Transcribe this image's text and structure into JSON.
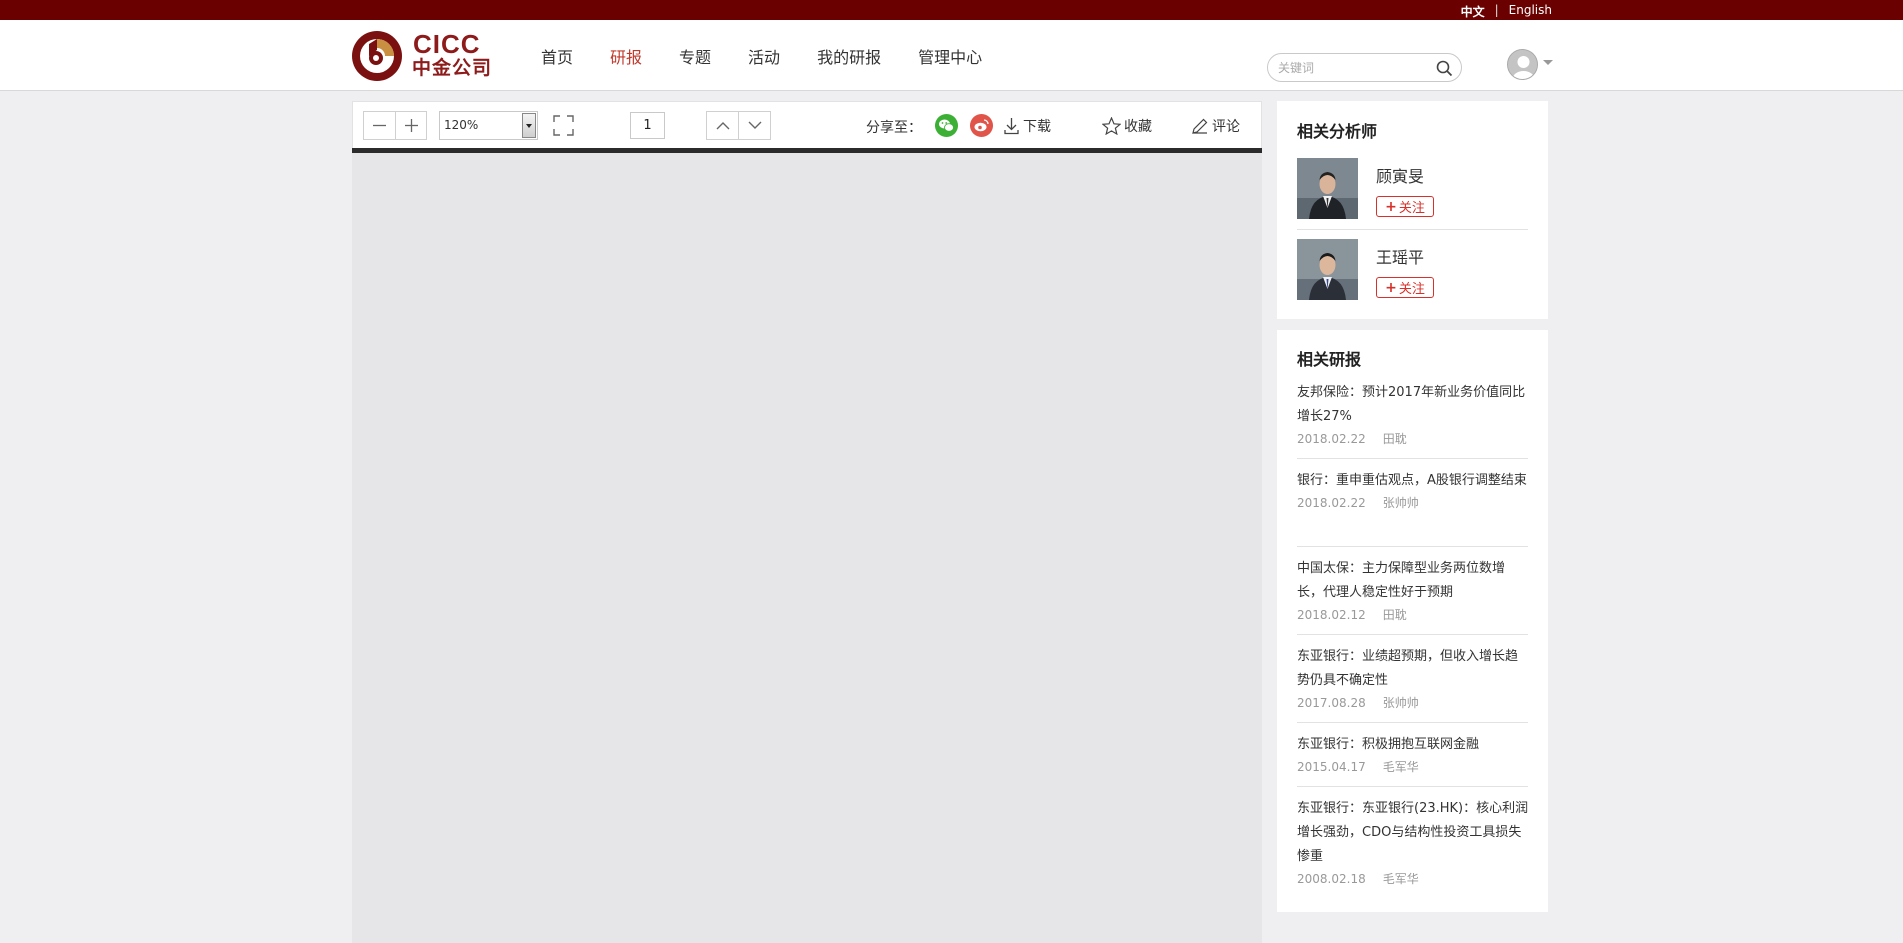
{
  "lang": {
    "chinese": "中文",
    "separator": "|",
    "english": "English"
  },
  "logo": {
    "en": "CICC",
    "cn": "中金公司"
  },
  "nav": {
    "items": [
      "首页",
      "研报",
      "专题",
      "活动",
      "我的研报",
      "管理中心"
    ],
    "active_index": 1,
    "active_color": "#c0392b"
  },
  "search": {
    "placeholder": "关键词",
    "value": ""
  },
  "viewer": {
    "zoom_value": "120%",
    "page_number": "1",
    "share_label": "分享至：",
    "download_label": "下载",
    "favorite_label": "收藏",
    "comment_label": "评论"
  },
  "analysts": {
    "title": "相关分析师",
    "items": [
      {
        "name": "顾寅旻",
        "follow_label": "关注"
      },
      {
        "name": "王瑶平",
        "follow_label": "关注"
      }
    ]
  },
  "reports": {
    "title": "相关研报",
    "items": [
      {
        "title": "友邦保险：预计2017年新业务价值同比增长27%",
        "date": "2018.02.22",
        "author": "田耽"
      },
      {
        "title": "银行：重申重估观点，A股银行调整结束",
        "date": "2018.02.22",
        "author": "张帅帅"
      },
      {
        "title": "中国太保：主力保障型业务两位数增长，代理人稳定性好于预期",
        "date": "2018.02.12",
        "author": "田耽"
      },
      {
        "title": "东亚银行：业绩超预期，但收入增长趋势仍具不确定性",
        "date": "2017.08.28",
        "author": "张帅帅"
      },
      {
        "title": "东亚银行：积极拥抱互联网金融",
        "date": "2015.04.17",
        "author": "毛军华"
      },
      {
        "title": "东亚银行：东亚银行(23.HK)：核心利润增长强劲，CDO与结构性投资工具损失惨重",
        "date": "2008.02.18",
        "author": "毛军华"
      }
    ]
  },
  "colors": {
    "topbar": "#6a0000",
    "brand": "#8e1b1b",
    "follow": "#d8302a",
    "wechat": "#3cb035",
    "weibo": "#e1544a"
  }
}
